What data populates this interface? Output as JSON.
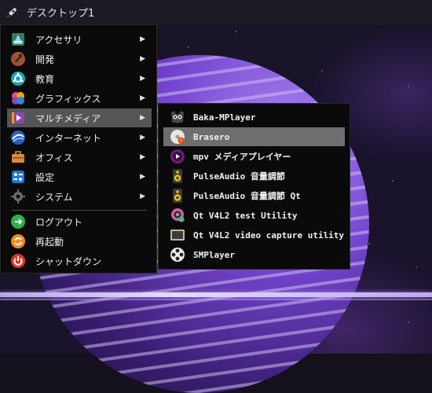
{
  "taskbar": {
    "start_label": "デスクトップ1",
    "start_icon": "rocket-icon"
  },
  "menu": {
    "items": [
      {
        "label": "アクセサリ",
        "icon": "accessories-icon",
        "has_submenu": true
      },
      {
        "label": "開発",
        "icon": "development-icon",
        "has_submenu": true
      },
      {
        "label": "教育",
        "icon": "education-icon",
        "has_submenu": true
      },
      {
        "label": "グラフィックス",
        "icon": "graphics-icon",
        "has_submenu": true
      },
      {
        "label": "マルチメディア",
        "icon": "multimedia-icon",
        "has_submenu": true,
        "active": true
      },
      {
        "label": "インターネット",
        "icon": "internet-icon",
        "has_submenu": true
      },
      {
        "label": "オフィス",
        "icon": "office-icon",
        "has_submenu": true
      },
      {
        "label": "設定",
        "icon": "settings-icon",
        "has_submenu": true
      },
      {
        "label": "システム",
        "icon": "system-icon",
        "has_submenu": true
      }
    ],
    "session_items": [
      {
        "label": "ログアウト",
        "icon": "logout-icon"
      },
      {
        "label": "再起動",
        "icon": "reboot-icon"
      },
      {
        "label": "シャットダウン",
        "icon": "shutdown-icon"
      }
    ],
    "arrow": "▶"
  },
  "submenu": {
    "items": [
      {
        "label": "Baka-MPlayer",
        "icon": "baka-mplayer-icon"
      },
      {
        "label": "Brasero",
        "icon": "brasero-icon",
        "active": true
      },
      {
        "label": "mpv メディアプレイヤー",
        "icon": "mpv-icon"
      },
      {
        "label": "PulseAudio 音量調節",
        "icon": "speaker-icon"
      },
      {
        "label": "PulseAudio 音量調節 Qt",
        "icon": "speaker-icon"
      },
      {
        "label": "Qt V4L2 test Utility",
        "icon": "webcam-icon"
      },
      {
        "label": "Qt V4L2 video capture utility",
        "icon": "video-capture-icon"
      },
      {
        "label": "SMPlayer",
        "icon": "smplayer-icon"
      }
    ]
  },
  "colors": {
    "menu_bg": "#0a0a0a",
    "active_item": "#555555",
    "active_subitem": "#6e6e6e",
    "text": "#f0f0f0"
  }
}
